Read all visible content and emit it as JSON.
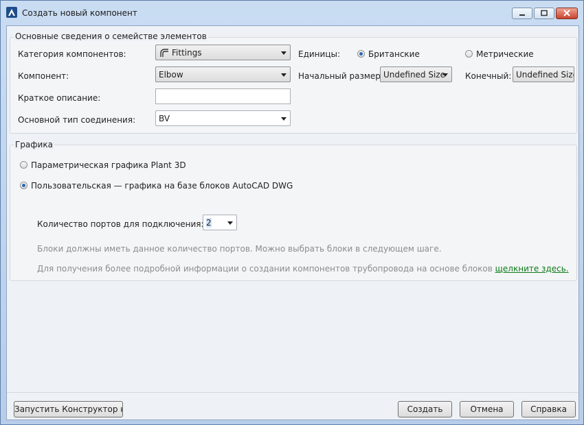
{
  "window": {
    "title": "Создать новый компонент"
  },
  "family_group": {
    "title": "Основные сведения о семействе элементов",
    "category": {
      "label": "Категория компонентов:",
      "value": "Fittings"
    },
    "component": {
      "label": "Компонент:",
      "value": "Elbow"
    },
    "short_description": {
      "label": "Краткое описание:",
      "value": ""
    },
    "connection_type": {
      "label": "Основной тип соединения:",
      "value": "BV"
    },
    "units": {
      "label": "Единицы:",
      "imperial": "Британские",
      "metric": "Метрические",
      "selected": "imperial"
    },
    "start_size": {
      "label": "Начальный размер:",
      "value": "Undefined Size"
    },
    "end_size": {
      "label": "Конечный:",
      "value": "Undefined Size"
    }
  },
  "graphics_group": {
    "title": "Графика",
    "option_parametric": "Параметрическая графика Plant 3D",
    "option_custom": "Пользовательская — графика на базе блоков AutoCAD DWG",
    "selected": "custom",
    "ports": {
      "label": "Количество портов для подключения:",
      "value": "2"
    },
    "hint1": "Блоки должны иметь данное количество портов. Можно выбрать блоки в следующем шаге.",
    "hint2_prefix": "Для получения более подробной информации о создании компонентов трубопровода на основе блоков ",
    "hint2_link": "щелкните здесь."
  },
  "buttons": {
    "catalog_builder": "Запустить Конструктор кат",
    "create": "Создать",
    "cancel": "Отмена",
    "help": "Справка"
  },
  "colors": {
    "link": "#0d7a17",
    "radio_dot": "#2a67b0",
    "close_button": "#c7442c"
  }
}
